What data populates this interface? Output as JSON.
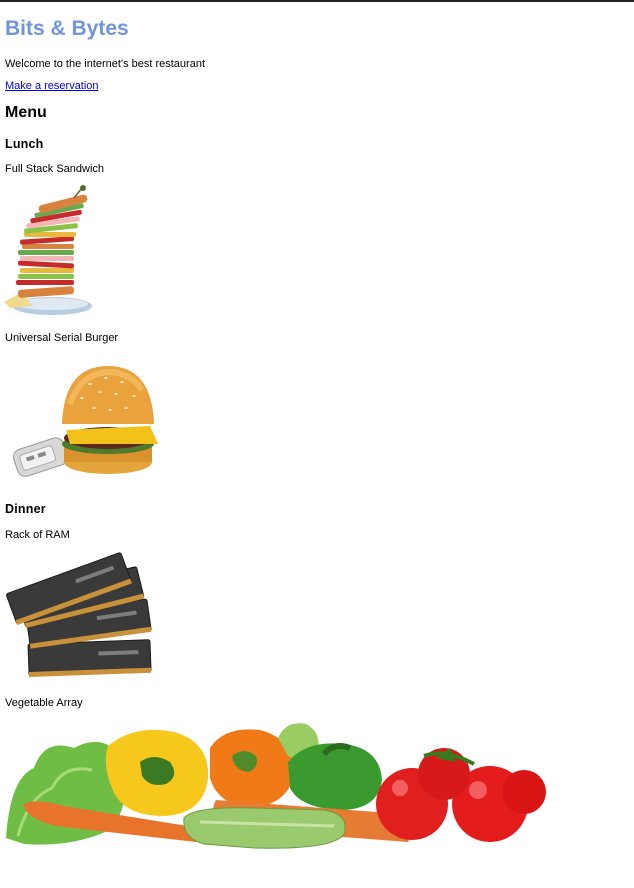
{
  "site": {
    "title": "Bits & Bytes",
    "tagline": "Welcome to the internet's best restaurant",
    "reservation_link": "Make a reservation",
    "title_color": "#6f95dc"
  },
  "menu": {
    "heading": "Menu",
    "sections": [
      {
        "heading": "Lunch",
        "items": [
          {
            "name": "Full Stack Sandwich",
            "image": "stacked-sandwich-image"
          },
          {
            "name": "Universal Serial Burger",
            "image": "usb-burger-image"
          }
        ]
      },
      {
        "heading": "Dinner",
        "items": [
          {
            "name": "Rack of RAM",
            "image": "ram-sticks-image"
          },
          {
            "name": "Vegetable Array",
            "image": "vegetables-image"
          }
        ]
      }
    ]
  }
}
